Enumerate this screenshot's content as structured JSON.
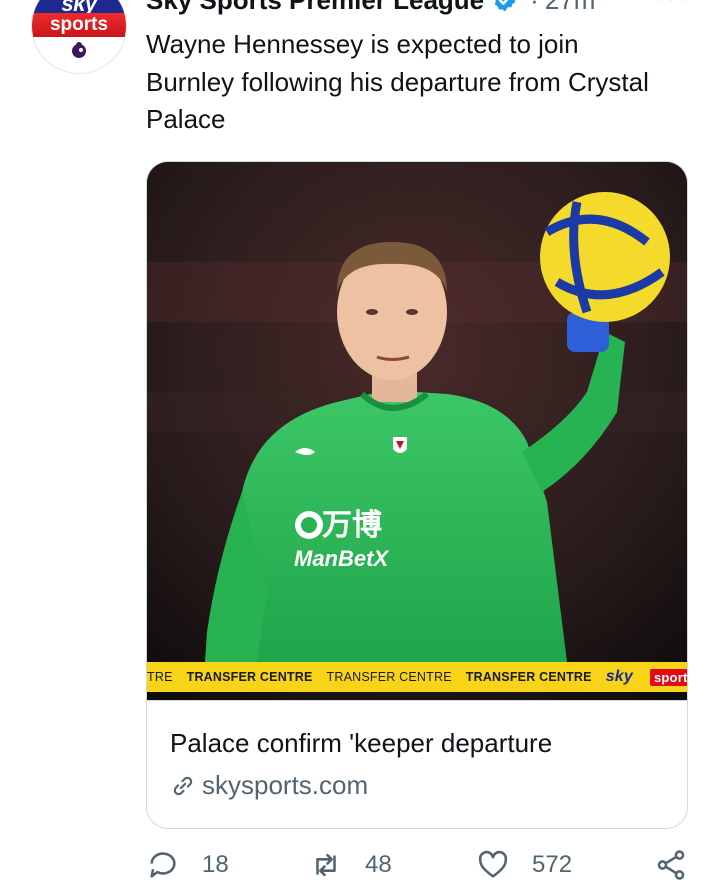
{
  "account": {
    "name": "Sky Sports Premier League",
    "avatar_text_top": "sky",
    "avatar_text_bottom": "sports"
  },
  "tweet": {
    "dot": "·",
    "time": "27m",
    "text": "Wayne Hennessey is expected to join Burnley following his departure from Crystal Palace"
  },
  "card": {
    "ticker": [
      "TRE",
      "TRANSFER CENTRE",
      "TRANSFER CENTRE",
      "TRANSFER CENTRE"
    ],
    "ticker_logo_sky": "sky",
    "ticker_logo_sports": "sports",
    "jersey_sponsor_cn": "万博",
    "jersey_sponsor": "ManBetX",
    "title": "Palace confirm 'keeper departure",
    "domain": "skysports.com"
  },
  "actions": {
    "reply_count": "18",
    "retweet_count": "48",
    "like_count": "572"
  },
  "icons": [
    "verified-icon",
    "more-icon",
    "link-icon",
    "reply-icon",
    "retweet-icon",
    "like-icon",
    "share-icon"
  ],
  "colors": {
    "verified_blue": "#1d9bf0",
    "ticker_yellow": "#f7d417",
    "sky_red": "#e10a15",
    "sky_blue": "#1c2a8f",
    "kit_green": "#2fbf56"
  }
}
